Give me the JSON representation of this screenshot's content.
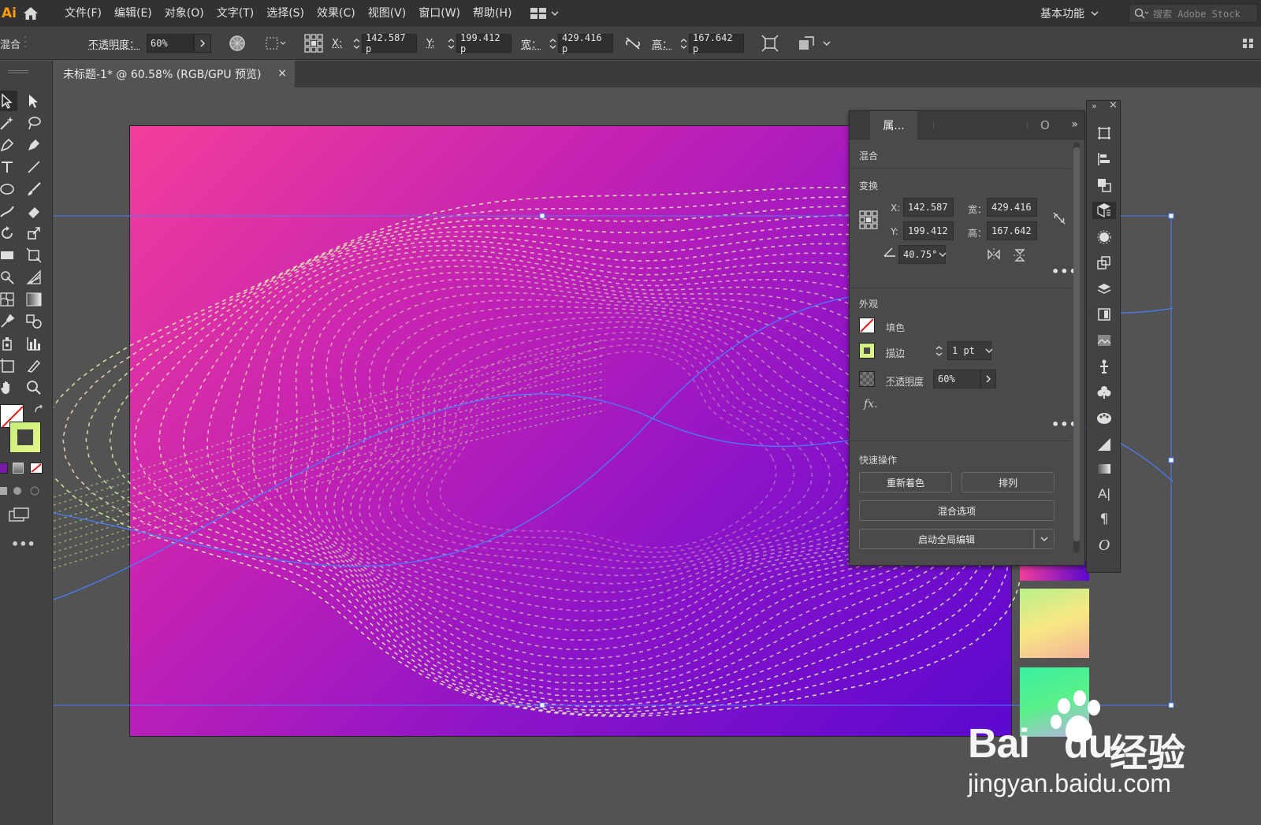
{
  "app": {
    "logo": "Ai"
  },
  "menu": [
    "文件(F)",
    "编辑(E)",
    "对象(O)",
    "文字(T)",
    "选择(S)",
    "效果(C)",
    "视图(V)",
    "窗口(W)",
    "帮助(H)"
  ],
  "workspace": {
    "label": "基本功能"
  },
  "search": {
    "placeholder": "搜索 Adobe Stock"
  },
  "control": {
    "object_type": "混合",
    "opacity_label": "不透明度：",
    "opacity_value": "60%",
    "x_label": "X:",
    "x_value": "142.587 p",
    "y_label": "Y:",
    "y_value": "199.412 p",
    "w_label": "宽：",
    "w_value": "429.416 p",
    "h_label": "高：",
    "h_value": "167.642 p"
  },
  "document": {
    "tab_title": "未标题-1* @ 60.58% (RGB/GPU 预览)",
    "close": "×"
  },
  "props": {
    "tab_label": "属...",
    "section_object": "混合",
    "section_transform": "变换",
    "x_label": "X:",
    "x_value": "142.587",
    "y_label": "Y:",
    "y_value": "199.412",
    "w_label": "宽：",
    "w_value": "429.416",
    "h_label": "高：",
    "h_value": "167.642",
    "angle_value": "40.75°",
    "section_appearance": "外观",
    "fill_label": "填色",
    "stroke_label": "描边",
    "stroke_value": "1 pt",
    "opacity_label": "不透明度",
    "opacity_value": "60%",
    "fx_label": "fx.",
    "section_quick": "快速操作",
    "btn_recolor": "重新着色",
    "btn_arrange": "排列",
    "btn_blend_options": "混合选项",
    "btn_global_edit": "启动全局编辑",
    "more": "•••"
  },
  "watermark": {
    "brand": "Bai",
    "brand2": "du",
    "cn": "经验",
    "url": "jingyan.baidu.com"
  },
  "colors": {
    "accent_selection": "#4a7cf7",
    "artboard_start": "#f23d9a",
    "artboard_end": "#5a08cf",
    "dashes": "#d8f0a8"
  }
}
